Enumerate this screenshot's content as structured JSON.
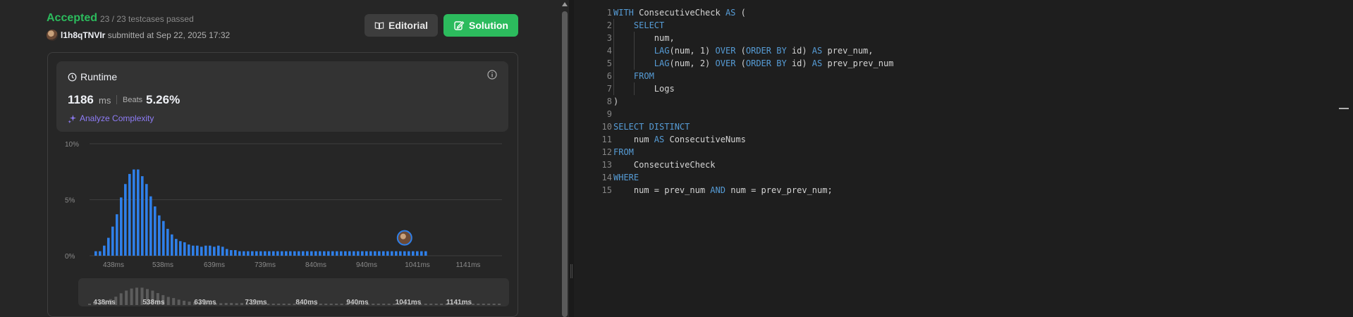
{
  "submission": {
    "status": "Accepted",
    "testcases": "23 / 23 testcases passed",
    "username": "l1h8qTNVIr",
    "submitted_text": "submitted at Sep 22, 2025 17:32"
  },
  "buttons": {
    "editorial": "Editorial",
    "solution": "Solution"
  },
  "runtime": {
    "title": "Runtime",
    "value": "1186",
    "unit": "ms",
    "beats_label": "Beats",
    "beats_value": "5.26%",
    "analyze_label": "Analyze Complexity"
  },
  "colors": {
    "accepted": "#2cbb5d",
    "bar": "#2f7fe8",
    "keyword": "#569cd6",
    "analyze": "#8e7cf6"
  },
  "chart_data": {
    "type": "bar",
    "ytick_labels": [
      "10%",
      "5%",
      "0%"
    ],
    "ylim": [
      0,
      10
    ],
    "xtick_labels": [
      "438ms",
      "538ms",
      "639ms",
      "739ms",
      "840ms",
      "940ms",
      "1041ms",
      "1141ms"
    ],
    "values": [
      0.4,
      0.4,
      0.9,
      1.6,
      2.6,
      3.7,
      5.2,
      6.4,
      7.3,
      7.7,
      7.7,
      7.1,
      6.4,
      5.3,
      4.4,
      3.6,
      3.1,
      2.4,
      1.9,
      1.5,
      1.3,
      1.2,
      1.0,
      0.9,
      0.9,
      0.8,
      0.9,
      0.9,
      0.8,
      0.9,
      0.8,
      0.6,
      0.5,
      0.5,
      0.4,
      0.4,
      0.4,
      0.4,
      0.4,
      0.4,
      0.4,
      0.4,
      0.4,
      0.4,
      0.4,
      0.4,
      0.4,
      0.4,
      0.4,
      0.4,
      0.4,
      0.4,
      0.4,
      0.4,
      0.4,
      0.4,
      0.4,
      0.4,
      0.4,
      0.4,
      0.4,
      0.4,
      0.4,
      0.4,
      0.4,
      0.4,
      0.4,
      0.4,
      0.4,
      0.4,
      0.4,
      0.4,
      0.4,
      0.4,
      0.4,
      0.4,
      0.4,
      0.4,
      0.4
    ],
    "marker_index": 73,
    "grid": true
  },
  "code": {
    "lines": [
      [
        [
          "kw",
          "WITH"
        ],
        [
          "t",
          " ConsecutiveCheck "
        ],
        [
          "kw",
          "AS"
        ],
        [
          "t",
          " ("
        ]
      ],
      [
        [
          "t",
          "    "
        ],
        [
          "kw",
          "SELECT"
        ]
      ],
      [
        [
          "t",
          "        num,"
        ]
      ],
      [
        [
          "t",
          "        "
        ],
        [
          "kw",
          "LAG"
        ],
        [
          "t",
          "(num, 1) "
        ],
        [
          "kw",
          "OVER"
        ],
        [
          "t",
          " ("
        ],
        [
          "kw",
          "ORDER BY"
        ],
        [
          "t",
          " id) "
        ],
        [
          "kw",
          "AS"
        ],
        [
          "t",
          " prev_num,"
        ]
      ],
      [
        [
          "t",
          "        "
        ],
        [
          "kw",
          "LAG"
        ],
        [
          "t",
          "(num, 2) "
        ],
        [
          "kw",
          "OVER"
        ],
        [
          "t",
          " ("
        ],
        [
          "kw",
          "ORDER BY"
        ],
        [
          "t",
          " id) "
        ],
        [
          "kw",
          "AS"
        ],
        [
          "t",
          " prev_prev_num"
        ]
      ],
      [
        [
          "t",
          "    "
        ],
        [
          "kw",
          "FROM"
        ]
      ],
      [
        [
          "t",
          "        Logs"
        ]
      ],
      [
        [
          "t",
          ")"
        ]
      ],
      [
        [
          "t",
          ""
        ]
      ],
      [
        [
          "kw",
          "SELECT DISTINCT"
        ]
      ],
      [
        [
          "t",
          "    num "
        ],
        [
          "kw",
          "AS"
        ],
        [
          "t",
          " ConsecutiveNums"
        ]
      ],
      [
        [
          "kw",
          "FROM"
        ]
      ],
      [
        [
          "t",
          "    ConsecutiveCheck"
        ]
      ],
      [
        [
          "kw",
          "WHERE"
        ]
      ],
      [
        [
          "t",
          "    num = prev_num "
        ],
        [
          "kw",
          "AND"
        ],
        [
          "t",
          " num = prev_prev_num;"
        ]
      ]
    ]
  }
}
